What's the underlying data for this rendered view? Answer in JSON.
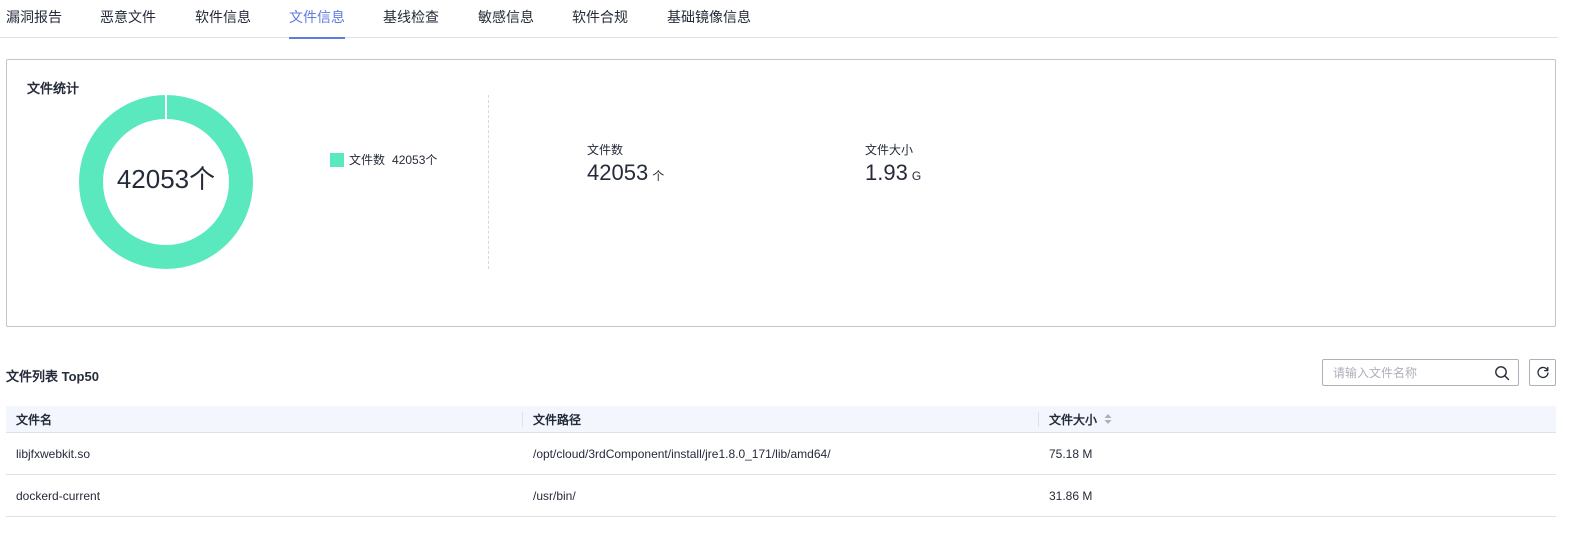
{
  "tabs": [
    {
      "label": "漏洞报告",
      "active": false
    },
    {
      "label": "恶意文件",
      "active": false
    },
    {
      "label": "软件信息",
      "active": false
    },
    {
      "label": "文件信息",
      "active": true
    },
    {
      "label": "基线检查",
      "active": false
    },
    {
      "label": "敏感信息",
      "active": false
    },
    {
      "label": "软件合规",
      "active": false
    },
    {
      "label": "基础镜像信息",
      "active": false
    }
  ],
  "stats": {
    "title": "文件统计",
    "donut_center": "42053个",
    "donut_color": "#5ae9bf",
    "legend_label": "文件数",
    "legend_value": "42053个",
    "file_count_label": "文件数",
    "file_count_value": "42053",
    "file_count_unit": "个",
    "file_size_label": "文件大小",
    "file_size_value": "1.93",
    "file_size_unit": "G"
  },
  "list": {
    "title": "文件列表 Top50",
    "search_placeholder": "请输入文件名称",
    "columns": {
      "name": "文件名",
      "path": "文件路径",
      "size": "文件大小"
    },
    "rows": [
      {
        "name": "libjfxwebkit.so",
        "path": "/opt/cloud/3rdComponent/install/jre1.8.0_171/lib/amd64/",
        "size": "75.18 M"
      },
      {
        "name": "dockerd-current",
        "path": "/usr/bin/",
        "size": "31.86 M"
      }
    ]
  },
  "colors": {
    "accent": "#5e7ce0",
    "donut": "#5ae9bf"
  }
}
